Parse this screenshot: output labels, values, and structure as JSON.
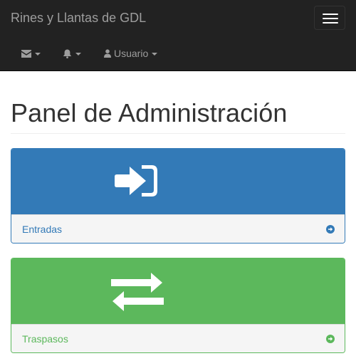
{
  "navbar": {
    "brand": "Rines y Llantas de GDL",
    "menu_toggle_icon": "hamburger-icon",
    "items": [
      {
        "icon": "envelope-icon",
        "label": ""
      },
      {
        "icon": "bell-icon",
        "label": ""
      },
      {
        "icon": "user-icon",
        "label": "Usuario"
      }
    ]
  },
  "page": {
    "title": "Panel de Administración"
  },
  "panels": [
    {
      "label": "Entradas",
      "icon": "sign-in-icon",
      "action_icon": "arrow-circle-right-icon",
      "color": "#337ab7"
    },
    {
      "label": "Traspasos",
      "icon": "exchange-icon",
      "action_icon": "arrow-circle-right-icon",
      "color": "#5cb85c"
    }
  ]
}
